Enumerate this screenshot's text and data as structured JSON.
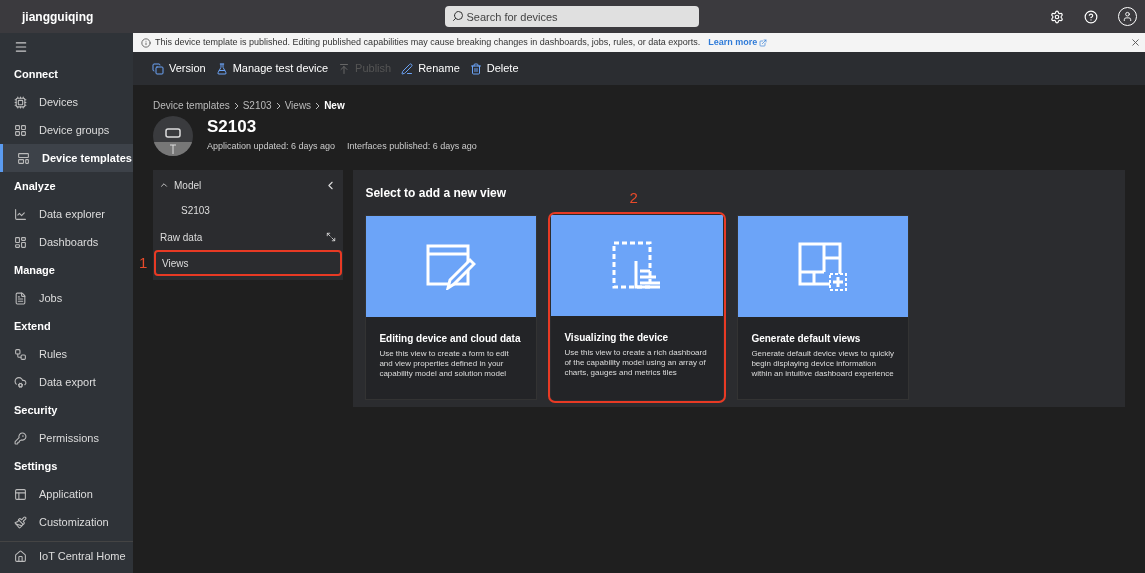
{
  "app_name": "jiangguiqing",
  "search": {
    "placeholder": "Search for devices"
  },
  "banner": {
    "message": "This device template is published. Editing published capabilities may cause breaking changes in dashboards, jobs, rules, or data exports.",
    "link": "Learn more"
  },
  "sidebar": {
    "sections": [
      {
        "title": "Connect",
        "items": [
          {
            "label": "Devices",
            "selected": false
          },
          {
            "label": "Device groups",
            "selected": false
          },
          {
            "label": "Device templates",
            "selected": true
          }
        ]
      },
      {
        "title": "Analyze",
        "items": [
          {
            "label": "Data explorer",
            "selected": false
          },
          {
            "label": "Dashboards",
            "selected": false
          }
        ]
      },
      {
        "title": "Manage",
        "items": [
          {
            "label": "Jobs",
            "selected": false
          }
        ]
      },
      {
        "title": "Extend",
        "items": [
          {
            "label": "Rules",
            "selected": false
          },
          {
            "label": "Data export",
            "selected": false
          }
        ]
      },
      {
        "title": "Security",
        "items": [
          {
            "label": "Permissions",
            "selected": false
          }
        ]
      },
      {
        "title": "Settings",
        "items": [
          {
            "label": "Application",
            "selected": false
          },
          {
            "label": "Customization",
            "selected": false
          }
        ]
      }
    ],
    "footer": {
      "label": "IoT Central Home"
    }
  },
  "toolbar": [
    {
      "label": "Version",
      "disabled": false
    },
    {
      "label": "Manage test device",
      "disabled": false
    },
    {
      "label": "Publish",
      "disabled": true
    },
    {
      "label": "Rename",
      "disabled": false
    },
    {
      "label": "Delete",
      "disabled": false
    }
  ],
  "breadcrumb": [
    {
      "label": "Device templates",
      "current": false
    },
    {
      "label": "S2103",
      "current": false
    },
    {
      "label": "Views",
      "current": false
    },
    {
      "label": "New",
      "current": true
    }
  ],
  "template": {
    "name": "S2103",
    "updated": "Application updated: 6 days ago",
    "published": "Interfaces published: 6 days ago"
  },
  "tree": {
    "title": "Model",
    "expanded": true,
    "children": [
      {
        "label": "S2103"
      }
    ],
    "items": [
      {
        "label": "Raw data",
        "kind": "expandable",
        "highlighted": false
      },
      {
        "label": "Views",
        "kind": "plain",
        "highlighted": true,
        "annotation": "1"
      }
    ]
  },
  "views_panel": {
    "title": "Select to add a new view",
    "cards": [
      {
        "kind": "form",
        "title": "Editing device and cloud data",
        "description": "Use this view to create a form to edit and view properties defined in your capability model and solution model",
        "highlighted": false
      },
      {
        "kind": "visual",
        "title": "Visualizing the device",
        "description": "Use this view to create a rich dashboard of the capability model using an array of charts, gauges and metrics tiles",
        "highlighted": true,
        "annotation": "2"
      },
      {
        "kind": "default",
        "title": "Generate default views",
        "description": "Generate default device views to quickly begin displaying device information within an intuitive dashboard experience",
        "highlighted": false
      }
    ]
  }
}
